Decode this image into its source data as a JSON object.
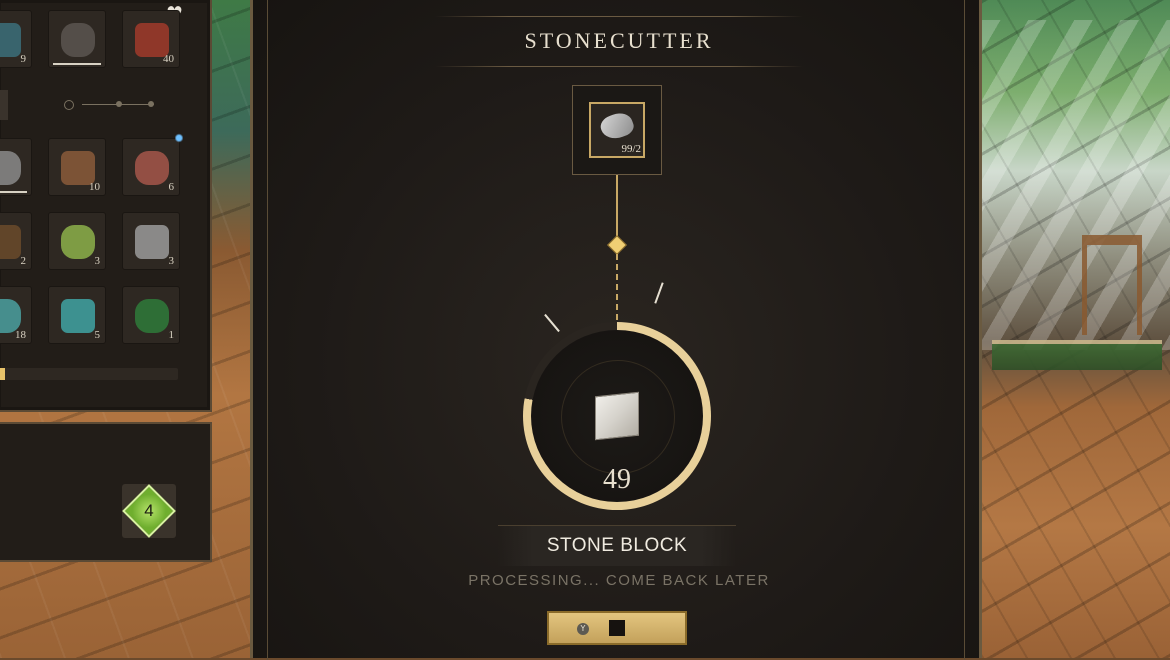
{
  "inventory": {
    "slots": [
      {
        "qty": "9",
        "icon": "blue-bar-icon",
        "color": "#3b6f7a"
      },
      {
        "qty": "",
        "icon": "hammer-icon",
        "color": "#5b5550",
        "equipped": true
      },
      {
        "qty": "40",
        "icon": "red-potion-icon",
        "color": "#a03a2a"
      },
      {
        "qty": "",
        "icon": "sword-icon",
        "color": "#8a8a8a",
        "equipped": true
      },
      {
        "qty": "10",
        "icon": "stick-icon",
        "color": "#8a5a3a"
      },
      {
        "qty": "6",
        "icon": "clay-icon",
        "color": "#a4564a"
      },
      {
        "qty": "2",
        "icon": "twig-icon",
        "color": "#6a4a2a"
      },
      {
        "qty": "3",
        "icon": "green-flask-icon",
        "color": "#8cb04a"
      },
      {
        "qty": "3",
        "icon": "mortar-icon",
        "color": "#9a9a9a"
      },
      {
        "qty": "18",
        "icon": "teal-ore-icon",
        "color": "#4aa0a0"
      },
      {
        "qty": "5",
        "icon": "teal-shell-icon",
        "color": "#3fa3a3"
      },
      {
        "qty": "1",
        "icon": "green-gem-icon",
        "color": "#2e7a3a"
      }
    ],
    "progress_fraction": 0.04
  },
  "player": {
    "level": "4"
  },
  "stonecutter": {
    "title": "STONECUTTER",
    "input": {
      "count": "99/2",
      "icon": "raw-stone-icon"
    },
    "output": {
      "count": "49",
      "name": "STONE BLOCK",
      "icon": "stone-block-icon",
      "progress_fraction": 0.78
    },
    "status": "PROCESSING... COME BACK LATER",
    "stop_button": {
      "key_hint": "Y",
      "icon": "stop-icon"
    }
  },
  "colors": {
    "accent_gold": "#c8a865",
    "panel_bg": "#1e1a17",
    "text_light": "#e7dfce",
    "text_muted": "#7a7366"
  }
}
